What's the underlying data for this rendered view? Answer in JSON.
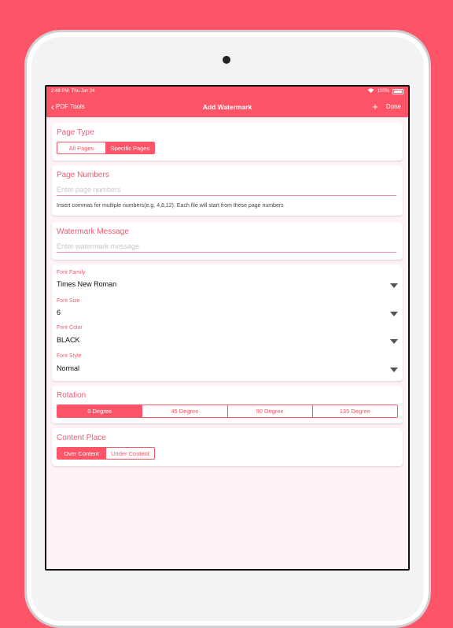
{
  "status": {
    "time": "2:48 PM",
    "date": "Thu Jan 24",
    "battery": "100%"
  },
  "nav": {
    "back_label": "PDF Tools",
    "title": "Add Watermark",
    "add_symbol": "+",
    "done_label": "Done"
  },
  "page_type": {
    "title": "Page Type",
    "options": [
      "All Pages",
      "Specific Pages"
    ],
    "selected": 1
  },
  "page_numbers": {
    "title": "Page Numbers",
    "placeholder": "Enter page numbers",
    "hint": "Insert commas for multiple numbers(e.g. 4,8,12). Each file will start from these page numbers"
  },
  "watermark": {
    "title": "Watermark Message",
    "placeholder": "Enter watermark message"
  },
  "font": {
    "family_label": "Font Family",
    "family_value": "Times New Roman",
    "size_label": "Font Size",
    "size_value": "6",
    "color_label": "Font Color",
    "color_value": "BLACK",
    "style_label": "Font Style",
    "style_value": "Normal"
  },
  "rotation": {
    "title": "Rotation",
    "options": [
      "0 Degree",
      "45 Degree",
      "90 Degree",
      "135 Degree"
    ],
    "selected": 0
  },
  "content_place": {
    "title": "Content Place",
    "options": [
      "Over Content",
      "Under Content"
    ],
    "selected": 0
  },
  "colors": {
    "accent": "#fe5468",
    "label": "#ee5a72",
    "background": "#fff3f7"
  }
}
